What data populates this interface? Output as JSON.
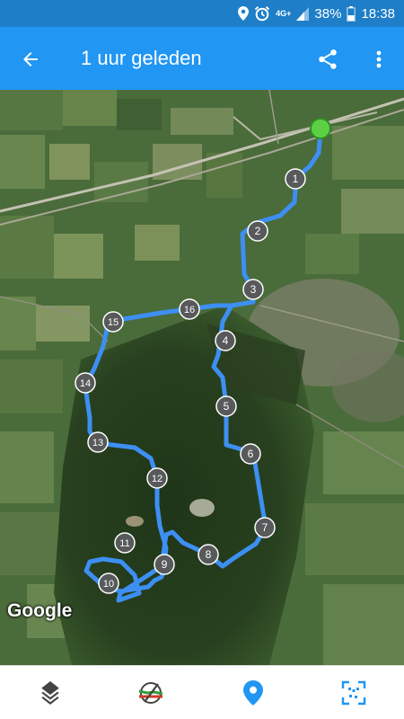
{
  "status_bar": {
    "network": "4G+",
    "battery": "38%",
    "time": "18:38"
  },
  "app_bar": {
    "title": "1 uur geleden",
    "icons": [
      "back-arrow-icon",
      "share-icon",
      "more-vert-icon"
    ]
  },
  "map": {
    "attribution": "Google",
    "route_color": "#3d8ff2",
    "start_marker_color": "#5cd042",
    "waypoint_labels": [
      "1",
      "2",
      "3",
      "4",
      "5",
      "6",
      "7",
      "8",
      "9",
      "10",
      "11",
      "12",
      "13",
      "14",
      "15",
      "16"
    ]
  },
  "bottom_bar": {
    "icons": [
      "layers-icon",
      "off-route-icon",
      "location-pin-icon",
      "scan-frame-icon"
    ],
    "active": "location-pin-icon",
    "active_color": "#2196f3"
  }
}
